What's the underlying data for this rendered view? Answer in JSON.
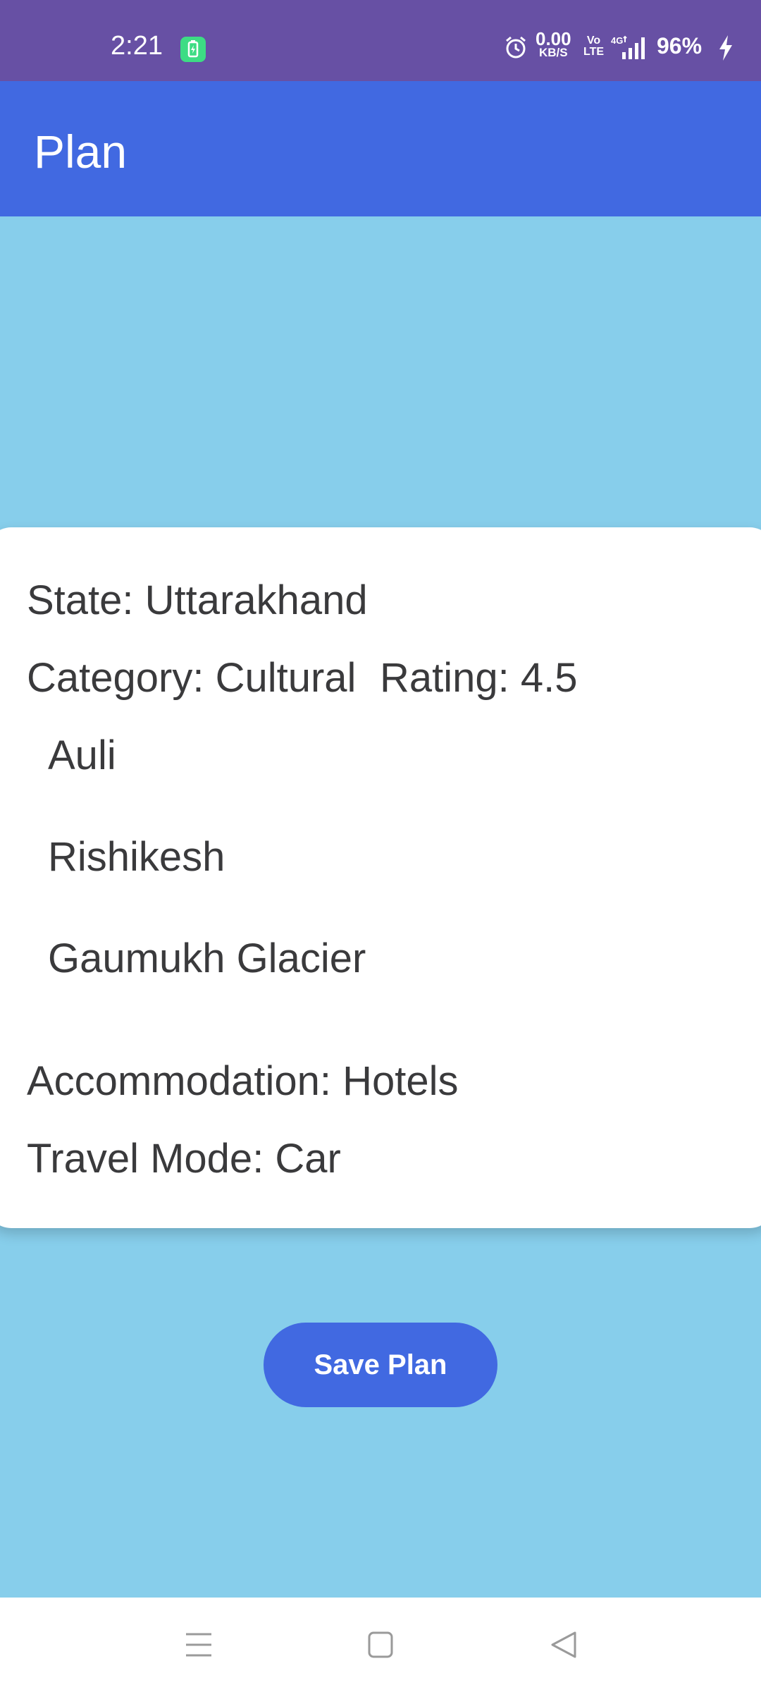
{
  "status_bar": {
    "time": "2:21",
    "data_speed_value": "0.00",
    "data_speed_unit": "KB/S",
    "volte_top": "Vo",
    "volte_bottom": "LTE",
    "battery": "96%",
    "icons": [
      "charging-app-icon",
      "alarm-icon",
      "signal-4g-icon",
      "charging-bolt-icon"
    ],
    "color": "#6750A4"
  },
  "app_bar": {
    "title": "Plan",
    "color": "#4169E1"
  },
  "plan": {
    "state": "State: Uttarakhand",
    "category": "Category: Cultural",
    "rating": "Rating: 4.5",
    "places": [
      "Auli",
      "Rishikesh",
      "Gaumukh Glacier"
    ],
    "accommodation": "Accommodation: Hotels",
    "travel_mode": "Travel Mode: Car"
  },
  "actions": {
    "save_label": "Save Plan"
  },
  "nav_bar": {
    "icons": [
      "menu-icon",
      "home-icon",
      "back-icon"
    ]
  },
  "colors": {
    "background": "#87CEEB",
    "accent": "#4169E1",
    "card": "#FFFFFF",
    "text": "#3A3A3C"
  }
}
